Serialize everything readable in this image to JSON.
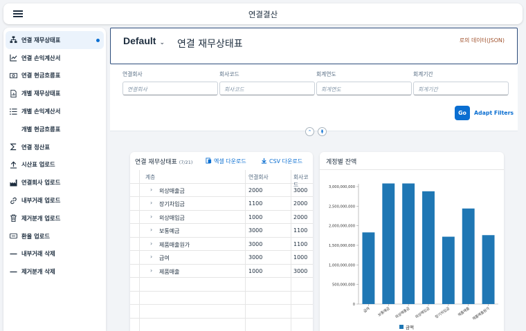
{
  "shell": {
    "title": "연결결산",
    "menu_icon": "hamburger-icon"
  },
  "sidebar": {
    "items": [
      {
        "label": "연결 재무상태표",
        "icon": "hierarchy-icon",
        "active": true
      },
      {
        "label": "연결 손익계산서",
        "icon": "chart-table-icon"
      },
      {
        "label": "연결 현금흐름표",
        "icon": "money-bills-icon"
      },
      {
        "label": "개별 재무상태표",
        "icon": "document-chart-icon"
      },
      {
        "label": "개별 손익계산서",
        "icon": "list-icon"
      },
      {
        "label": "개별 현금흐름표",
        "icon": ""
      },
      {
        "label": "연결 정산표",
        "icon": "sum-icon"
      },
      {
        "label": "시산표 업로드",
        "icon": "upload-icon"
      },
      {
        "label": "연결회사 업로드",
        "icon": "factory-icon"
      },
      {
        "label": "내부거래 업로드",
        "icon": "chain-link-icon"
      },
      {
        "label": "제거분개 업로드",
        "icon": "delete-icon"
      },
      {
        "label": "환율 업로드",
        "icon": "currency-icon"
      },
      {
        "label": "내부거래 삭제",
        "icon": "dash-icon"
      },
      {
        "label": "제거분개 삭제",
        "icon": "dash-icon"
      }
    ]
  },
  "header": {
    "variant": "Default",
    "page_title": "연결 재무상태표",
    "json_link": "로의 데이터(JSON)"
  },
  "filters": [
    {
      "label": "연결회사",
      "placeholder": "연결회사"
    },
    {
      "label": "회사코드",
      "placeholder": "회사코드"
    },
    {
      "label": "회계연도",
      "placeholder": "회계연도"
    },
    {
      "label": "회계기간",
      "placeholder": "회계기간"
    }
  ],
  "filter_bar": {
    "go": "Go",
    "adapt": "Adapt Filters"
  },
  "table": {
    "title": "연결 재무상태표",
    "count": "(7/21)",
    "excel_btn": "엑셀 다운로드",
    "csv_btn": "CSV 다운로드",
    "columns": [
      "계층",
      "연결회사",
      "회사코드"
    ],
    "rows": [
      {
        "name": "외상매출금",
        "company": "2000",
        "code": "3000"
      },
      {
        "name": "장기차입금",
        "company": "1100",
        "code": "2000"
      },
      {
        "name": "외상매입금",
        "company": "1000",
        "code": "2000"
      },
      {
        "name": "보통예금",
        "company": "3000",
        "code": "1100"
      },
      {
        "name": "제품매출원가",
        "company": "3000",
        "code": "1100"
      },
      {
        "name": "급여",
        "company": "3000",
        "code": "1000"
      },
      {
        "name": "제품매출",
        "company": "1000",
        "code": "3000"
      }
    ]
  },
  "chart_data": {
    "type": "bar",
    "title": "계정별 잔액",
    "categories": [
      "급여",
      "보통예금",
      "외상매출금",
      "외상매입금",
      "장기차입금",
      "제품매출",
      "제품매출원가"
    ],
    "series": [
      {
        "name": "금액",
        "values": [
          1830000000,
          3080000000,
          3080000000,
          2880000000,
          1720000000,
          2440000000,
          1760000000
        ],
        "color": "#1f77b4"
      }
    ],
    "ylim": [
      0,
      3000000000
    ],
    "yticks": [
      "0",
      "500,000,000",
      "1,000,000,000",
      "1,500,000,000",
      "2,000,000,000",
      "2,500,000,000",
      "3,000,000,000"
    ],
    "legend": "bottom"
  }
}
